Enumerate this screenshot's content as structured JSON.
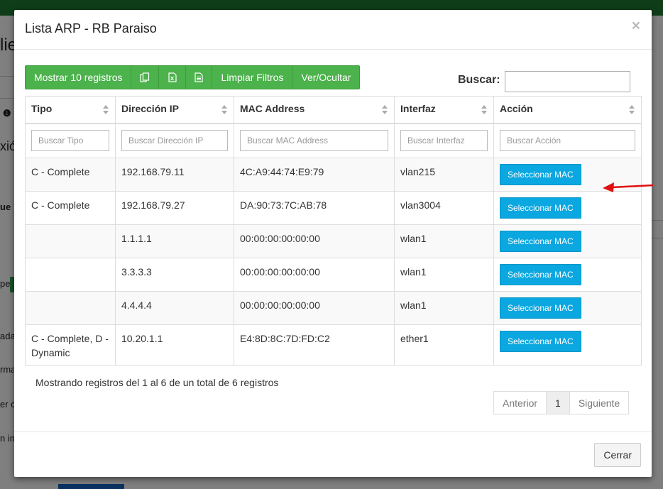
{
  "background": {
    "fragments": [
      "lie",
      "xió",
      "ue",
      "pe",
      "ada",
      "rma",
      "er c",
      "n in"
    ]
  },
  "modal": {
    "title": "Lista ARP - RB Paraiso",
    "close_symbol": "×"
  },
  "toolbar": {
    "show_records": "Mostrar 10 registros",
    "copy_icon": "copy-icon",
    "excel_icon": "excel-icon",
    "csv_icon": "csv-icon",
    "clear_filters": "Limpiar Filtros",
    "show_hide": "Ver/Ocultar"
  },
  "search": {
    "label": "Buscar:",
    "value": ""
  },
  "table": {
    "headers": [
      "Tipo",
      "Dirección IP",
      "MAC Address",
      "Interfaz",
      "Acción"
    ],
    "filters": [
      "Buscar Tipo",
      "Buscar Dirección IP",
      "Buscar MAC Address",
      "Buscar Interfaz",
      "Buscar Acción"
    ],
    "rows": [
      {
        "tipo": "C - Complete",
        "ip": "192.168.79.11",
        "mac": "4C:A9:44:74:E9:79",
        "interfaz": "vlan215",
        "accion": "Seleccionar MAC"
      },
      {
        "tipo": "C - Complete",
        "ip": "192.168.79.27",
        "mac": "DA:90:73:7C:AB:78",
        "interfaz": "vlan3004",
        "accion": "Seleccionar MAC"
      },
      {
        "tipo": "",
        "ip": "1.1.1.1",
        "mac": "00:00:00:00:00:00",
        "interfaz": "wlan1",
        "accion": "Seleccionar MAC"
      },
      {
        "tipo": "",
        "ip": "3.3.3.3",
        "mac": "00:00:00:00:00:00",
        "interfaz": "wlan1",
        "accion": "Seleccionar MAC"
      },
      {
        "tipo": "",
        "ip": "4.4.4.4",
        "mac": "00:00:00:00:00:00",
        "interfaz": "wlan1",
        "accion": "Seleccionar MAC"
      },
      {
        "tipo": "C - Complete, D - Dynamic",
        "ip": "10.20.1.1",
        "mac": "E4:8D:8C:7D:FD:C2",
        "interfaz": "ether1",
        "accion": "Seleccionar MAC"
      }
    ]
  },
  "info": "Mostrando registros del 1 al 6 de un total de 6 registros",
  "pagination": {
    "previous": "Anterior",
    "current": "1",
    "next": "Siguiente"
  },
  "footer": {
    "close_label": "Cerrar"
  },
  "colors": {
    "green_button": "#4cb24c",
    "blue_button": "#0aa7e0",
    "arrow": "#e01010"
  }
}
